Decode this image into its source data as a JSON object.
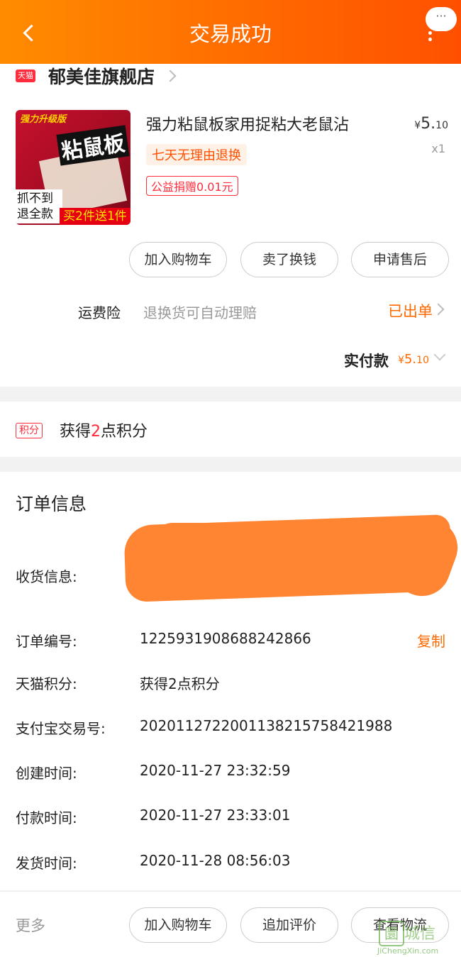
{
  "header": {
    "title": "交易成功",
    "more_bubble": "···"
  },
  "shop": {
    "badge": "天猫",
    "name": "郁美佳旗舰店"
  },
  "product": {
    "image_text": {
      "top": "强力升级版",
      "main": "粘鼠板",
      "left": "抓不到退全款",
      "promo": "买2件送1件"
    },
    "title": "强力粘鼠板家用捉粘大老鼠沾",
    "price_symbol": "¥",
    "price_int": "5.",
    "price_dec": "10",
    "qty": "x1",
    "tag_return": "七天无理由退换",
    "tag_charity": "公益捐赠0.01元"
  },
  "actions": {
    "cart": "加入购物车",
    "sell": "卖了换钱",
    "after_sale": "申请售后"
  },
  "insurance": {
    "label": "运费险",
    "desc": "退换货可自动理赔",
    "status": "已出单"
  },
  "paid": {
    "label": "实付款",
    "symbol": "¥",
    "int": "5.",
    "dec": "10"
  },
  "points": {
    "badge": "积分",
    "prefix": "获得",
    "num": "2",
    "suffix": "点积分"
  },
  "order": {
    "title": "订单信息",
    "receiver_label": "收货信息:",
    "rows": [
      {
        "label": "订单编号:",
        "value": "1225931908688242866"
      },
      {
        "label": "天猫积分:",
        "value": "获得2点积分"
      },
      {
        "label": "支付宝交易号:",
        "value": "2020112722001138215758421988"
      },
      {
        "label": "创建时间:",
        "value": "2020-11-27 23:32:59"
      },
      {
        "label": "付款时间:",
        "value": "2020-11-27 23:33:01"
      },
      {
        "label": "发货时间:",
        "value": "2020-11-28 08:56:03"
      }
    ],
    "copy": "复制"
  },
  "bottom": {
    "more": "更多",
    "cart": "加入购物车",
    "review": "追加评价",
    "logistics": "查看物流"
  },
  "watermark": {
    "icon": "圜",
    "text": "城信",
    "sub": "JiChengXin.com"
  },
  "colors": {
    "accent": "#ff5000",
    "header_start": "#ff8c00",
    "tmall_red": "#ff2c3b"
  }
}
